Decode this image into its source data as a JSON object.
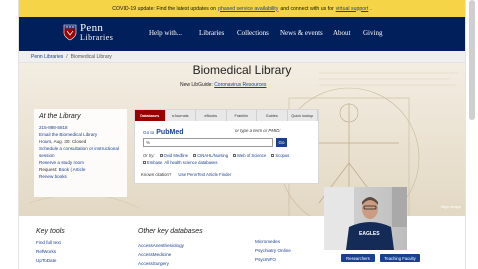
{
  "alert": {
    "prefix": "COVID-19 update: Find the latest updates on",
    "link1": "phased service availability",
    "middle": "and connect with us for",
    "link2": "virtual support",
    "suffix": "."
  },
  "header": {
    "logo_line1": "Penn",
    "logo_line2": "Libraries",
    "nav": [
      "Help with...",
      "Libraries",
      "Collections",
      "News & events",
      "About",
      "Giving"
    ]
  },
  "breadcrumb": {
    "items": [
      "Penn Libraries",
      "/",
      "Biomedical Library"
    ]
  },
  "hero": {
    "title": "Biomedical Library",
    "guide_prefix": "New LibGuide:",
    "guide_link": "Coronavirus Resources",
    "credit": "Bigo image"
  },
  "at_library": {
    "heading": "At the Library",
    "phone": "215-898-5818",
    "email": "Email the Biomedical Library",
    "hours": "Hours",
    "hours_text": ", Aug. 30: Closed",
    "consult": "Schedule a consultation or instructional session",
    "reserve": "Reserve a study room",
    "request_label": "Request:",
    "request_book": "Book",
    "request_sep": "|",
    "request_article": "Article",
    "renew": "Renew books"
  },
  "search": {
    "tabs": [
      "Databases",
      "eJournals",
      "eBooks",
      "Franklin",
      "Guides",
      "Quick lookup"
    ],
    "go_to": "Go to",
    "pubmed_a": "Pub",
    "pubmed_b": "Med",
    "hint": "or type a term or PMID:",
    "query": "%",
    "go_button": "Go",
    "or_try": "Or try:",
    "options": [
      "Ovid Medline",
      "CINAHL/Nursing",
      "Web of Science",
      "Scopus"
    ],
    "embase": "Embase",
    "all_dbs": "All health science databases",
    "citation_label": "Known citation?",
    "citation_link": "Use PennText Article Finder"
  },
  "key_tools": {
    "heading": "Key tools",
    "items": [
      "Find full text",
      "RefWorks",
      "UpToDate"
    ]
  },
  "key_databases": {
    "heading": "Other key databases",
    "col1": [
      "AccessAnesthesiology",
      "AccessMedicine",
      "AccessSurgery"
    ],
    "col2": [
      "Micromedex",
      "Psychiatry Online",
      "PsycINFO"
    ]
  },
  "webcam": {
    "shirt_text": "EAGLES",
    "buttons": [
      "Researchers",
      "Teaching Faculty"
    ]
  },
  "colors": {
    "penn_blue": "#011f5b",
    "alert_yellow": "#f5d547",
    "active_tab": "#990000",
    "link": "#1a3f8f"
  }
}
